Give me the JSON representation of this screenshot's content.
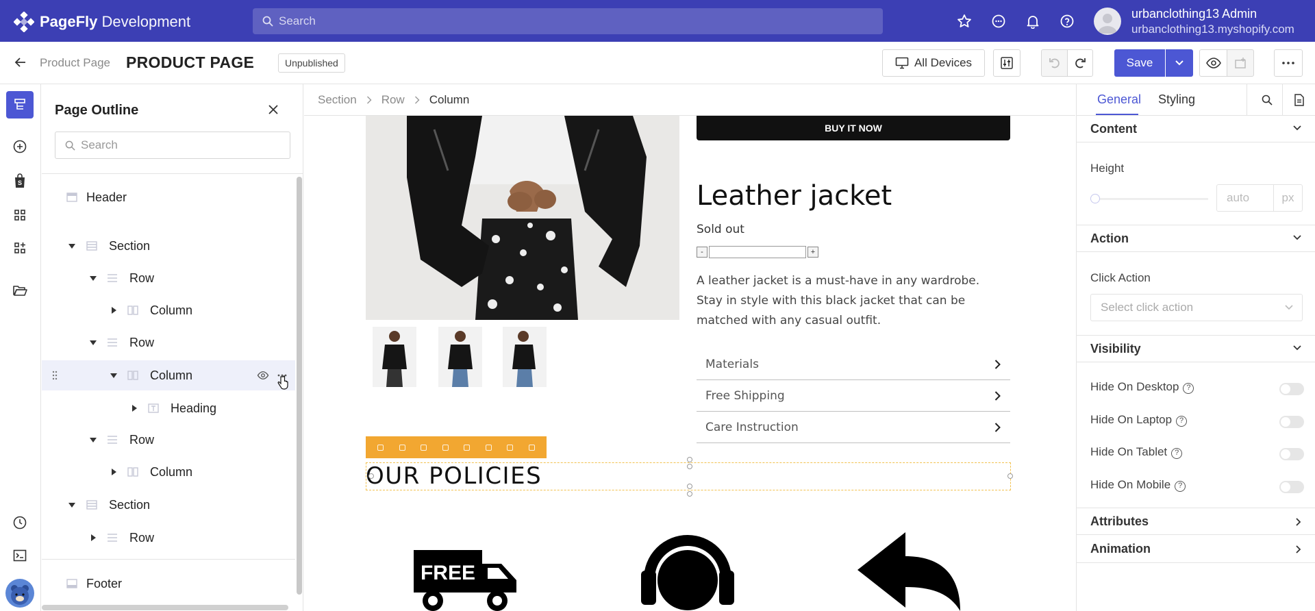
{
  "topbar": {
    "brand": "PageFly",
    "env": "Development",
    "search_placeholder": "Search",
    "user_name": "urbanclothing13 Admin",
    "shop_url": "urbanclothing13.myshopify.com"
  },
  "subbar": {
    "crumb": "Product Page",
    "title": "PRODUCT PAGE",
    "status": "Unpublished",
    "devices": "All Devices",
    "save": "Save"
  },
  "outline": {
    "title": "Page Outline",
    "search_placeholder": "Search",
    "nodes": [
      {
        "label": "Header"
      },
      {
        "label": "Section"
      },
      {
        "label": "Row"
      },
      {
        "label": "Column"
      },
      {
        "label": "Row"
      },
      {
        "label": "Column"
      },
      {
        "label": "Heading"
      },
      {
        "label": "Row"
      },
      {
        "label": "Column"
      },
      {
        "label": "Section"
      },
      {
        "label": "Row"
      },
      {
        "label": "Footer"
      }
    ]
  },
  "canvas": {
    "breadcrumb": [
      "Section",
      "Row",
      "Column"
    ],
    "buy_now": "BUY IT NOW",
    "product_title": "Leather jacket",
    "stock": "Sold out",
    "qty_minus": "-",
    "qty_plus": "+",
    "description": "A leather jacket is a must-have in any wardrobe. Stay in style with this black jacket that can be matched with any casual outfit.",
    "accordions": [
      "Materials",
      "Free Shipping",
      "Care Instruction"
    ],
    "heading": "OUR POLICIES",
    "truck_text": "FREE"
  },
  "panel": {
    "tabs": [
      "General",
      "Styling"
    ],
    "content": "Content",
    "height_label": "Height",
    "height_value": "auto",
    "height_unit": "px",
    "action": "Action",
    "click_action_label": "Click Action",
    "click_action_placeholder": "Select click action",
    "visibility": "Visibility",
    "hide": [
      "Hide On Desktop",
      "Hide On Laptop",
      "Hide On Tablet",
      "Hide On Mobile"
    ],
    "attributes": "Attributes",
    "animation": "Animation"
  },
  "colors": {
    "topbar": "#3c3fb4",
    "accent": "#4c57d4",
    "selection_toolbar": "#f2a731"
  }
}
